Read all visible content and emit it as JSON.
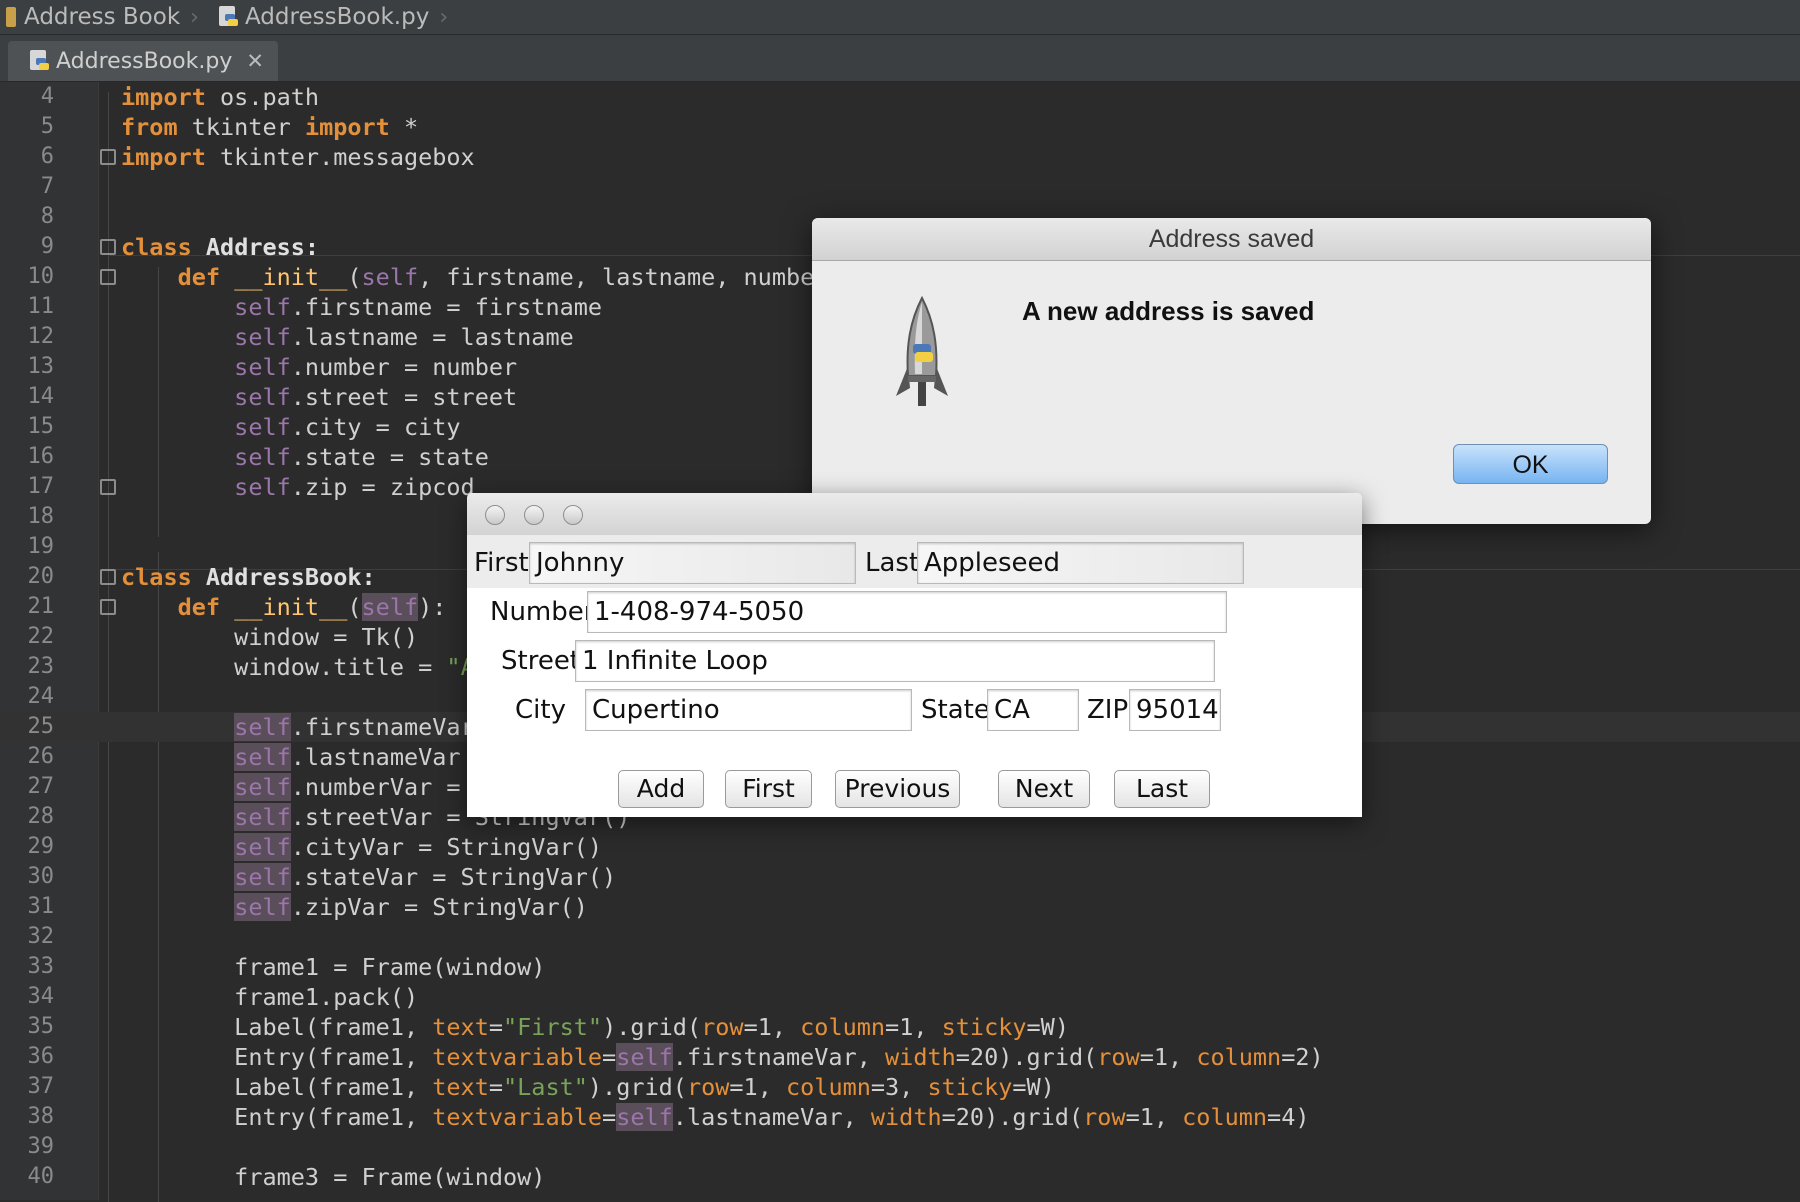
{
  "breadcrumb": {
    "project": "Address Book",
    "file": "AddressBook.py"
  },
  "tabs": [
    {
      "label": "AddressBook.py",
      "close": "✕"
    }
  ],
  "editor": {
    "lines": [
      {
        "n": "4"
      },
      {
        "n": "5"
      },
      {
        "n": "6"
      },
      {
        "n": "7"
      },
      {
        "n": "8"
      },
      {
        "n": "9"
      },
      {
        "n": "10"
      },
      {
        "n": "11"
      },
      {
        "n": "12"
      },
      {
        "n": "13"
      },
      {
        "n": "14"
      },
      {
        "n": "15"
      },
      {
        "n": "16"
      },
      {
        "n": "17"
      },
      {
        "n": "18"
      },
      {
        "n": "19"
      },
      {
        "n": "20"
      },
      {
        "n": "21"
      },
      {
        "n": "22"
      },
      {
        "n": "23"
      },
      {
        "n": "24"
      },
      {
        "n": "25"
      },
      {
        "n": "26"
      },
      {
        "n": "27"
      },
      {
        "n": "28"
      },
      {
        "n": "29"
      },
      {
        "n": "30"
      },
      {
        "n": "31"
      },
      {
        "n": "32"
      },
      {
        "n": "33"
      },
      {
        "n": "34"
      },
      {
        "n": "35"
      },
      {
        "n": "36"
      },
      {
        "n": "37"
      },
      {
        "n": "38"
      },
      {
        "n": "39"
      },
      {
        "n": "40"
      }
    ],
    "code": {
      "l4a": "import",
      "l4b": " os.path",
      "l5a": "from",
      "l5b": " tkinter ",
      "l5c": "import",
      "l5d": " *",
      "l6a": "import",
      "l6b": " tkinter.messagebox",
      "l9a": "class",
      "l9b": " Address:",
      "l10a": "    def ",
      "l10b": "__init__",
      "l10c": "(",
      "l10d": "self",
      "l10e": ", firstname, lastname, numbe",
      "l11a": "        self",
      "l11b": ".firstname = firstname",
      "l12a": "        self",
      "l12b": ".lastname = lastname",
      "l13a": "        self",
      "l13b": ".number = number",
      "l14a": "        self",
      "l14b": ".street = street",
      "l15a": "        self",
      "l15b": ".city = city",
      "l16a": "        self",
      "l16b": ".state = state",
      "l17a": "        self",
      "l17b": ".zip = zipcod",
      "l20a": "class",
      "l20b": " AddressBook:",
      "l21a": "    def ",
      "l21b": "__init__",
      "l21c": "(",
      "l21d": "self",
      "l21e": "):",
      "l22a": "        window = Tk()",
      "l23a": "        window.title = ",
      "l23b": "\"A",
      "l25a": "        ",
      "l25b": "self",
      "l25c": ".firstnameVar",
      "l26a": "        ",
      "l26b": "self",
      "l26c": ".lastnameVar",
      "l27a": "        ",
      "l27b": "self",
      "l27c": ".numberVar =",
      "l28a": "        ",
      "l28b": "self",
      "l28c": ".streetVar = StringVar()",
      "l29a": "        ",
      "l29b": "self",
      "l29c": ".cityVar = StringVar()",
      "l30a": "        ",
      "l30b": "self",
      "l30c": ".stateVar = StringVar()",
      "l31a": "        ",
      "l31b": "self",
      "l31c": ".zipVar = StringVar()",
      "l33a": "        frame1 = Frame(window)",
      "l34a": "        frame1.pack()",
      "l35a": "        Label(frame1, ",
      "l35b": "text",
      "l35c": "=",
      "l35d": "\"First\"",
      "l35e": ").grid(",
      "l35f": "row",
      "l35g": "=1, ",
      "l35h": "column",
      "l35i": "=1, ",
      "l35j": "sticky",
      "l35k": "=W)",
      "l36a": "        Entry(frame1, ",
      "l36b": "textvariable",
      "l36c": "=",
      "l36d": "self",
      "l36e": ".firstnameVar, ",
      "l36f": "width",
      "l36g": "=20).grid(",
      "l36h": "row",
      "l36i": "=1, ",
      "l36j": "column",
      "l36k": "=2)",
      "l37a": "        Label(frame1, ",
      "l37b": "text",
      "l37c": "=",
      "l37d": "\"Last\"",
      "l37e": ").grid(",
      "l37f": "row",
      "l37g": "=1, ",
      "l37h": "column",
      "l37i": "=3, ",
      "l37j": "sticky",
      "l37k": "=W)",
      "l38a": "        Entry(frame1, ",
      "l38b": "textvariable",
      "l38c": "=",
      "l38d": "self",
      "l38e": ".lastnameVar, ",
      "l38f": "width",
      "l38g": "=20).grid(",
      "l38h": "row",
      "l38i": "=1, ",
      "l38j": "column",
      "l38k": "=4)",
      "l40a": "        frame3 = Frame(window)"
    }
  },
  "alert": {
    "title": "Address saved",
    "message": "A new address is saved",
    "ok_label": "OK",
    "icon": "python-launcher-rocket-icon"
  },
  "tk_window": {
    "first_label": "First",
    "first_value": "Johnny",
    "last_label": "Last",
    "last_value": "Appleseed",
    "number_label": "Number",
    "number_value": "1-408-974-5050",
    "street_label": "Street",
    "street_value": "1 Infinite Loop",
    "city_label": "City",
    "city_value": "Cupertino",
    "state_label": "State",
    "state_value": "CA",
    "zip_label": "ZIP",
    "zip_value": "95014",
    "buttons": {
      "add": "Add",
      "first": "First",
      "previous": "Previous",
      "next": "Next",
      "last": "Last"
    }
  }
}
